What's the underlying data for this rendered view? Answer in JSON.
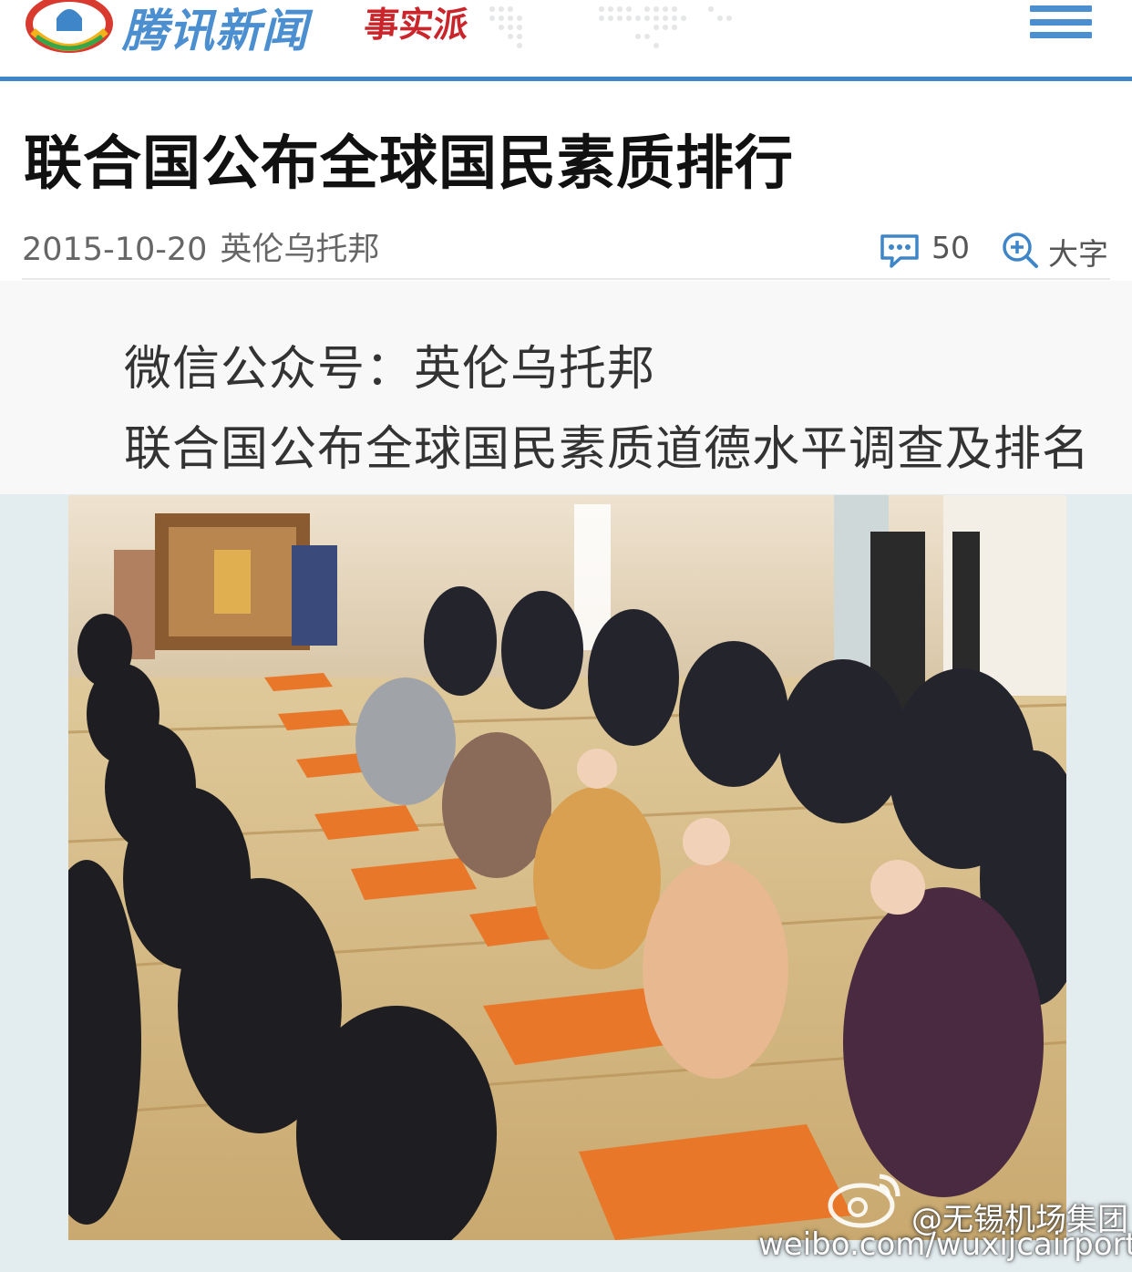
{
  "header": {
    "logo_text": "腾讯新闻",
    "logo_sub": "事实派",
    "brand_color": "#4c8fd0",
    "accent_color": "#c9252a"
  },
  "article": {
    "title": "联合国公布全球国民素质排行",
    "date": "2015-10-20",
    "source": "英伦乌托邦",
    "comment_count": "50",
    "font_size_label": "大字",
    "paragraphs": [
      "微信公众号：英伦乌托邦",
      "联合国公布全球国民素质道德水平调查及排名"
    ]
  },
  "watermark": {
    "handle": "@无锡机场集团",
    "url": "weibo.com/wuxijcairport"
  },
  "icons": {
    "menu": "hamburger-menu-icon",
    "comment": "speech-bubble-icon",
    "zoom": "zoom-in-icon",
    "weibo": "weibo-eye-icon"
  }
}
